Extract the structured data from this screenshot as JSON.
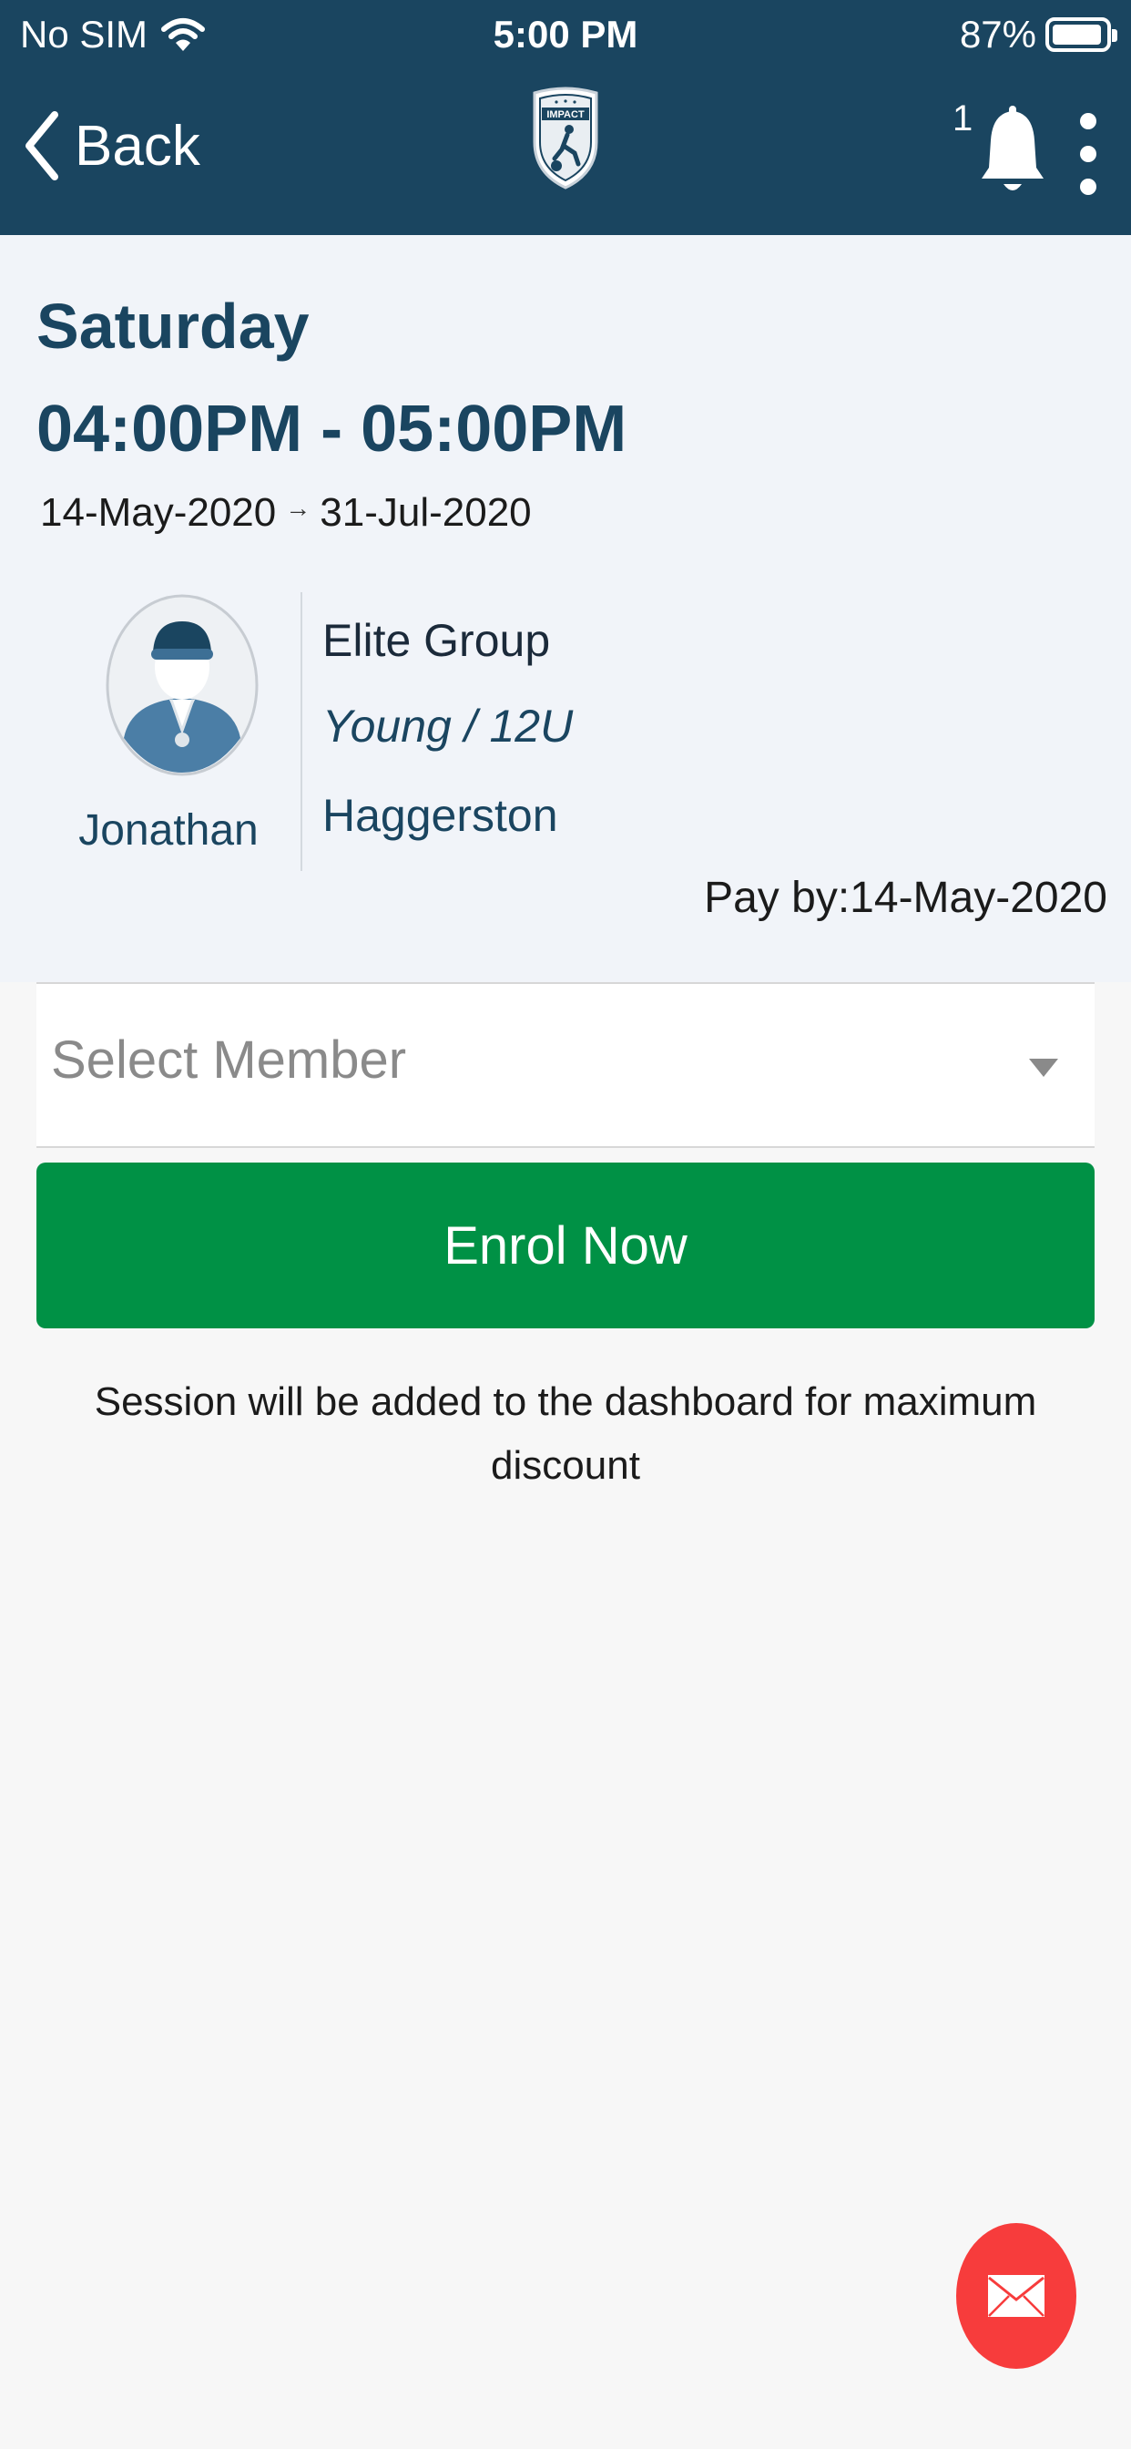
{
  "status_bar": {
    "carrier": "No SIM",
    "time": "5:00 PM",
    "battery": "87%",
    "battery_level": 0.87
  },
  "navbar": {
    "back_label": "Back",
    "logo_text": "IMPACT",
    "notification_count": "1"
  },
  "session": {
    "day": "Saturday",
    "time_range": "04:00PM - 05:00PM",
    "start_date": "14-May-2020",
    "end_date": "31-Jul-2020",
    "coach_name": "Jonathan",
    "group_name": "Elite Group",
    "age_group": "Young / 12U",
    "location": "Haggerston",
    "pay_by": "Pay by:14-May-2020"
  },
  "form": {
    "select_member_placeholder": "Select Member",
    "enrol_label": "Enrol Now",
    "note": "Session will be added to the dashboard for maximum discount"
  },
  "colors": {
    "header": "#1a4560",
    "enrol": "#009145",
    "fab": "#f73c3c"
  }
}
